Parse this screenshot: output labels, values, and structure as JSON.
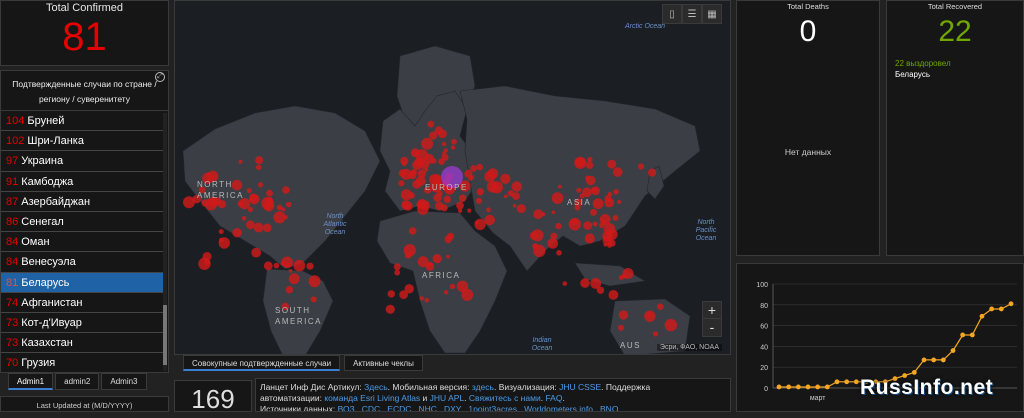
{
  "total_confirmed": {
    "label": "Total Confirmed",
    "value": "81"
  },
  "country_list": {
    "header": "Подтвержденные случаи по стране / региону / суверенитету",
    "items": [
      {
        "count": "104",
        "name": "Бруней"
      },
      {
        "count": "102",
        "name": "Шри-Ланка"
      },
      {
        "count": "97",
        "name": "Украина"
      },
      {
        "count": "91",
        "name": "Камбоджа"
      },
      {
        "count": "87",
        "name": "Азербайджан"
      },
      {
        "count": "86",
        "name": "Сенегал"
      },
      {
        "count": "84",
        "name": "Оман"
      },
      {
        "count": "84",
        "name": "Венесуэла"
      },
      {
        "count": "81",
        "name": "Беларусь",
        "selected": true
      },
      {
        "count": "74",
        "name": "Афганистан"
      },
      {
        "count": "73",
        "name": "Кот-д'Ивуар"
      },
      {
        "count": "73",
        "name": "Казахстан"
      },
      {
        "count": "70",
        "name": "Грузия"
      }
    ]
  },
  "admin_tabs": [
    "Admin1",
    "admin2",
    "Admin3"
  ],
  "last_updated": "Last Updated at (M/D/YYYY)",
  "map": {
    "oceans": {
      "arctic": "Arctic Ocean",
      "north_atlantic": "North Atlantic Ocean",
      "north_pacific": "North Pacific Ocean",
      "indian": "Indian Ocean"
    },
    "continents": {
      "north_america": "NORTH AMERICA",
      "south_america": "SOUTH AMERICA",
      "europe": "EUROPE",
      "africa": "AFRICA",
      "asia": "ASIA",
      "australia": "AUS"
    },
    "attribution": "Эсри, ФАО, NOAA",
    "zoom_in": "+",
    "zoom_out": "-",
    "tab_icons": [
      "bookmark-icon",
      "list-icon",
      "qr-icon"
    ]
  },
  "map_tabs": [
    "Совокупные подтвержденные случаи",
    "Активные чеклы"
  ],
  "countries_count": "169",
  "info": {
    "l1_a": "Ланцет Инф Дис Артикул: ",
    "l1_link1": "Здесь",
    "l1_b": ". Мобильная версия: ",
    "l1_link2": "здесь",
    "l1_c": ". Визуализация: ",
    "l1_link3": "JHU CSSE",
    "l1_d": ". Поддержка",
    "l2_a": "автоматизации: ",
    "l2_link1": "команда Esri Living Atlas",
    "l2_b": " и ",
    "l2_link2": "JHU APL",
    "l2_c": ". ",
    "l2_link3": "Свяжитесь с нами",
    "l2_d": ". ",
    "l2_link4": "FAQ",
    "l2_e": ".",
    "l3_a": "Источники данных: ",
    "l3_links": "ВОЗ , CDC , ECDC , NHC , DXY , 1point3acres , Worldometers.info , BNO"
  },
  "deaths": {
    "label": "Total Deaths",
    "value": "0",
    "no_data": "Нет данных"
  },
  "recovered": {
    "label": "Total Recovered",
    "value": "22",
    "line1": "22 выздоровел",
    "line2": "Беларусь"
  },
  "chart_data": {
    "type": "line",
    "xlabel": "",
    "ylabel": "",
    "x_tick_label": "март",
    "ylim": [
      0,
      100
    ],
    "yticks": [
      0,
      20,
      40,
      60,
      80,
      100
    ],
    "color": "#f5a623",
    "series": [
      {
        "values": [
          1,
          1,
          1,
          1,
          1,
          1,
          6,
          6,
          6,
          6,
          6,
          6,
          9,
          12,
          15,
          27,
          27,
          27,
          36,
          51,
          51,
          69,
          76,
          76,
          81
        ]
      }
    ]
  },
  "watermark": "RussInfo.net"
}
